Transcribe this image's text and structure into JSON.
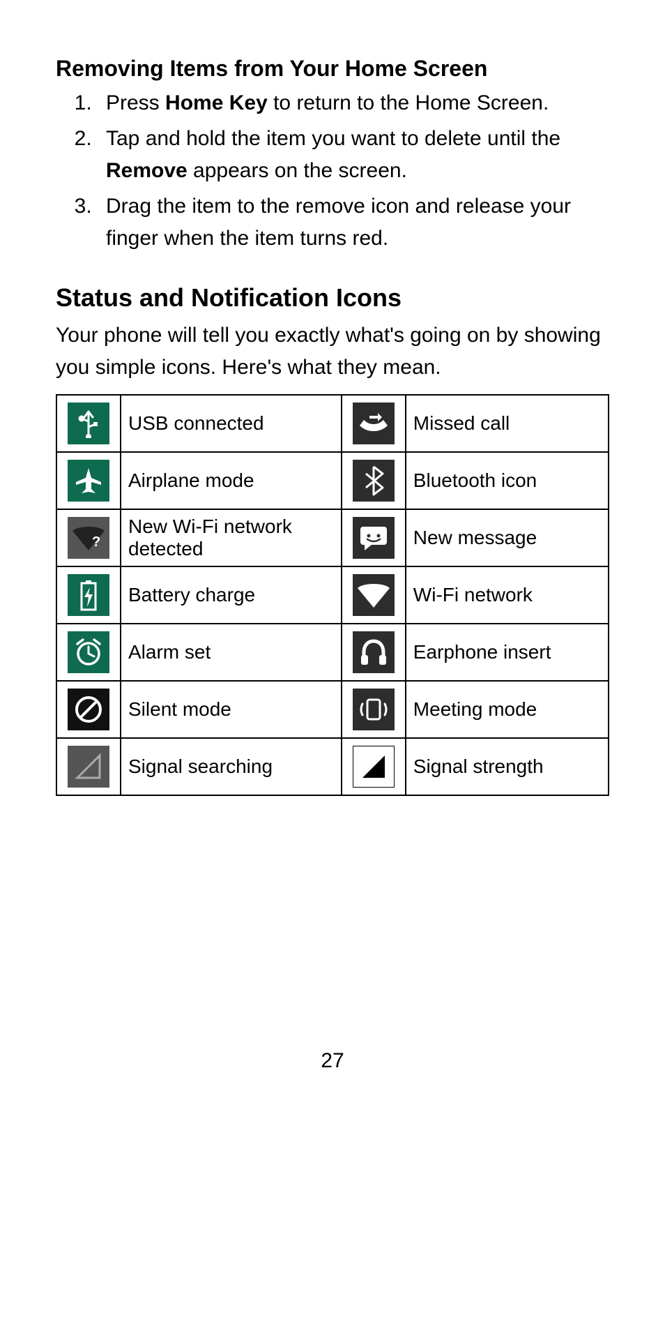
{
  "section1": {
    "title": "Removing Items from Your Home Screen",
    "steps": {
      "s1a": "Press ",
      "s1b": "Home Key",
      "s1c": " to return to the Home Screen.",
      "s2a": "Tap and hold the item you want to delete until the ",
      "s2b": "Remove",
      "s2c": " appears on the screen.",
      "s3": "Drag the item to the remove icon and release your finger when the item turns red."
    }
  },
  "section2": {
    "heading": "Status and Notification Icons",
    "intro": "Your phone will tell you exactly what's going on by showing you simple icons. Here's what they mean."
  },
  "icons": {
    "left": [
      "USB connected",
      "Airplane mode",
      "New Wi-Fi network detected",
      "Battery charge",
      "Alarm set",
      "Silent mode",
      "Signal searching"
    ],
    "right": [
      "Missed call",
      "Bluetooth icon",
      "New message",
      "Wi-Fi network",
      "Earphone insert",
      "Meeting mode",
      "Signal strength"
    ]
  },
  "page_number": "27"
}
